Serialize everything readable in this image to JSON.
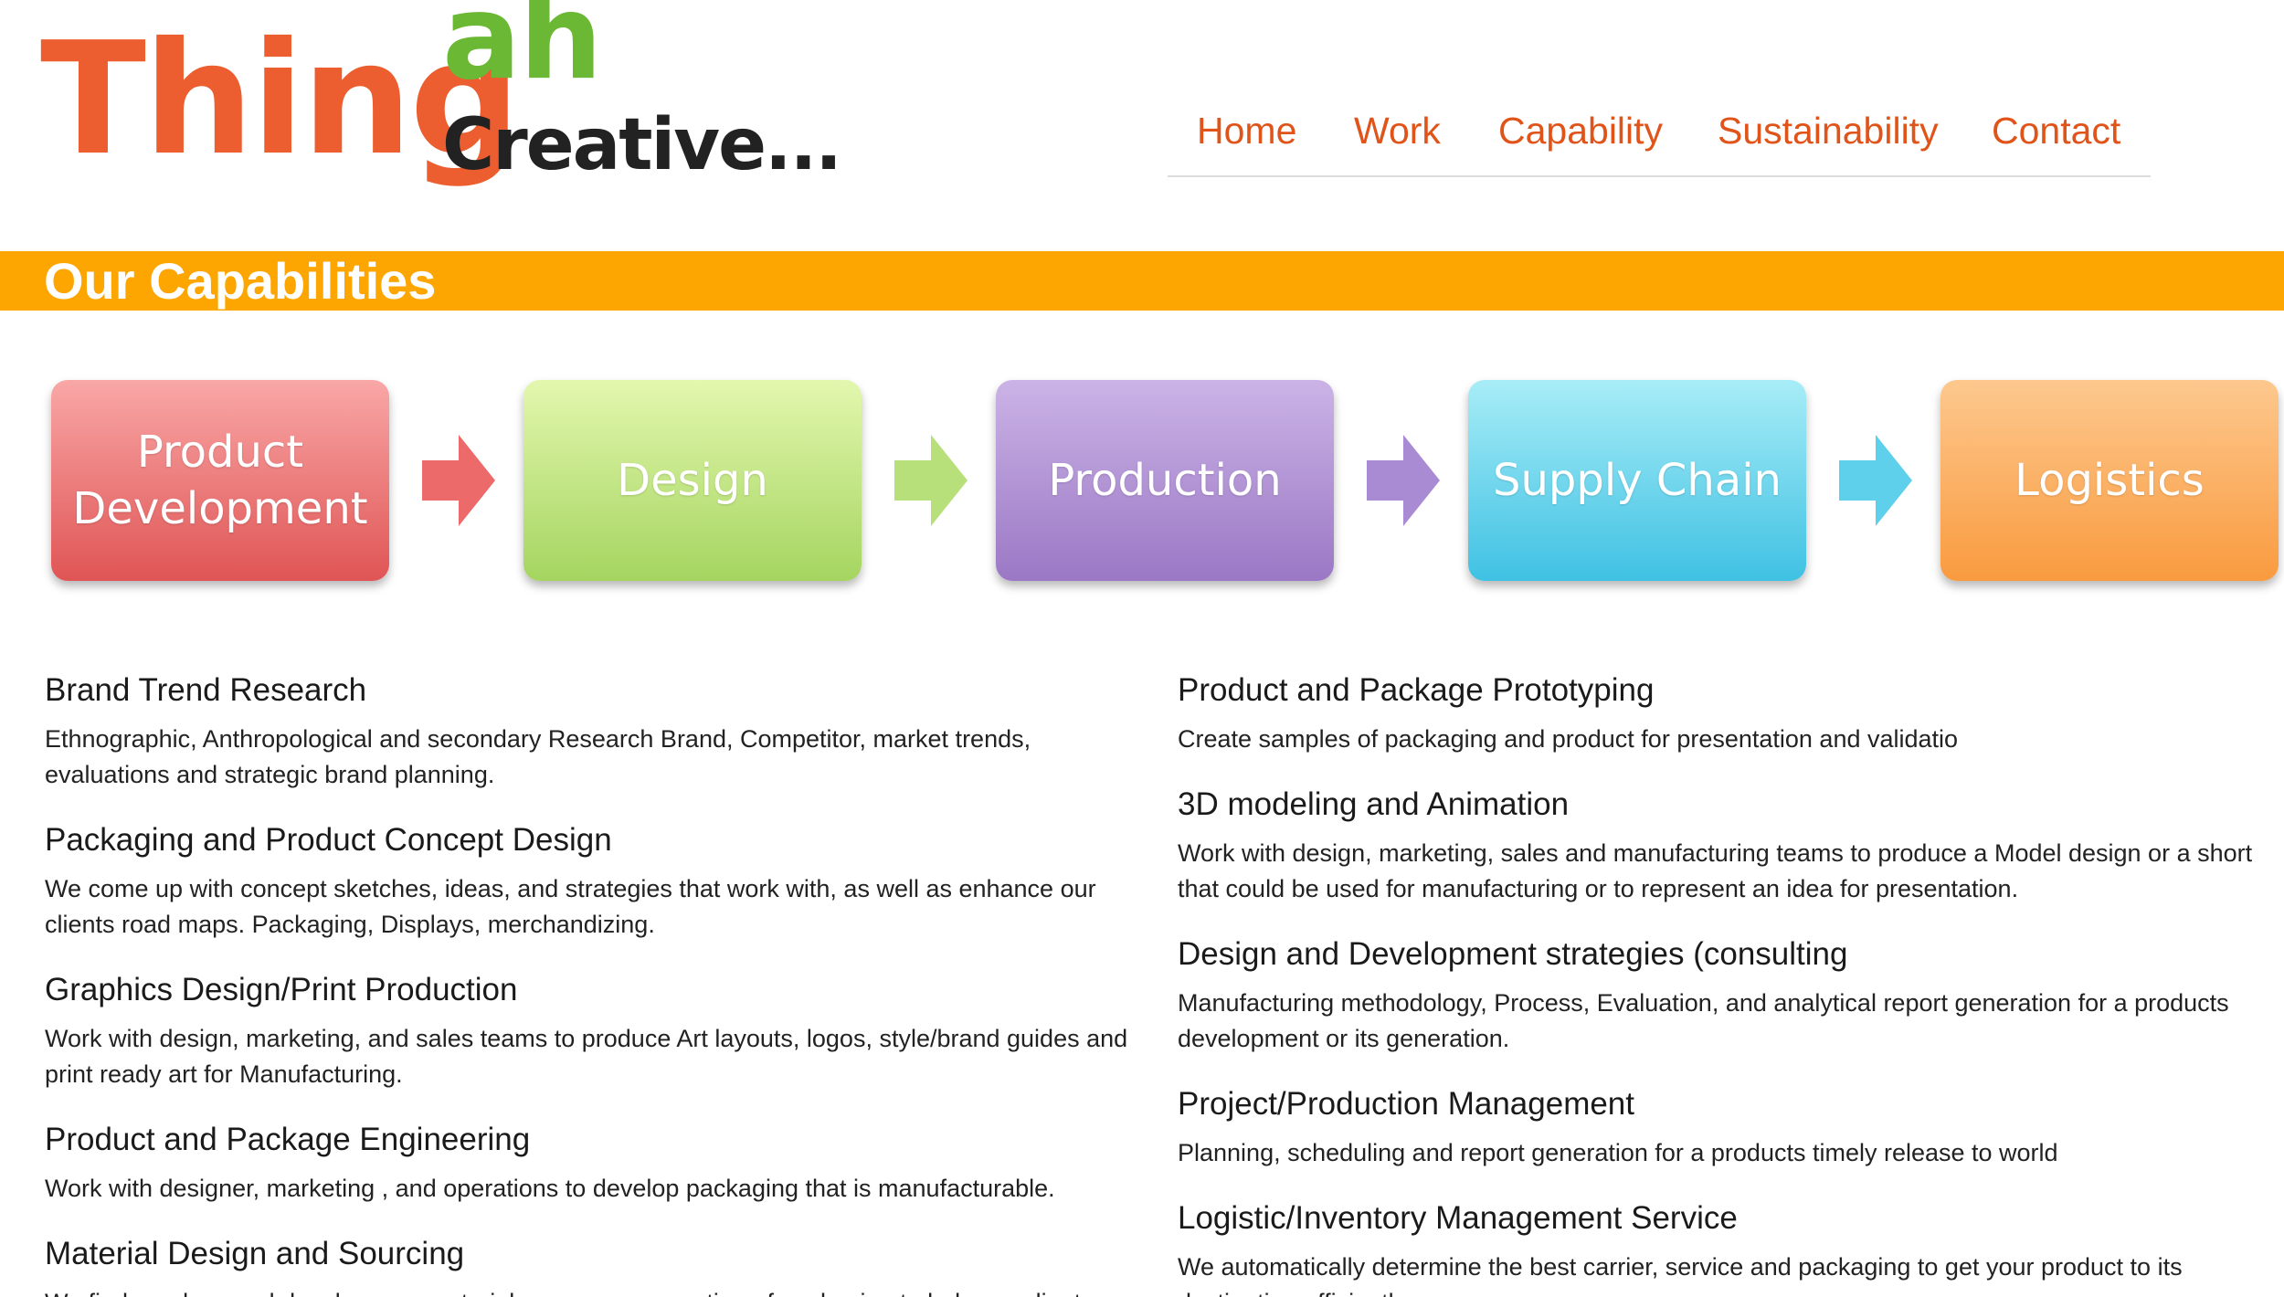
{
  "logo": {
    "part_thing": "Thing",
    "part_ah": "ah",
    "part_creative": "Creative..."
  },
  "nav": {
    "items": [
      {
        "label": "Home"
      },
      {
        "label": "Work"
      },
      {
        "label": "Capability"
      },
      {
        "label": "Sustainability"
      },
      {
        "label": "Contact"
      }
    ]
  },
  "section": {
    "title": "Our Capabilities"
  },
  "process": {
    "steps": [
      {
        "label": "Product Development"
      },
      {
        "label": "Design"
      },
      {
        "label": "Production"
      },
      {
        "label": "Supply Chain"
      },
      {
        "label": "Logistics"
      }
    ],
    "arrow_colors": [
      "#ec6a6a",
      "#b8e07a",
      "#a98bd3",
      "#5fd0ec"
    ]
  },
  "capabilities": {
    "left": [
      {
        "title": "Brand Trend Research",
        "desc": "Ethnographic, Anthropological and secondary Research Brand, Competitor, market trends, evaluations and strategic brand planning."
      },
      {
        "title": "Packaging and Product Concept Design",
        "desc": "We come up with concept sketches, ideas, and strategies that work with, as well as enhance our clients road maps. Packaging, Displays, merchandizing."
      },
      {
        "title": "Graphics Design/Print Production",
        "desc": "Work with design, marketing, and sales teams to produce Art layouts, logos, style/brand guides and print ready art for Manufacturing."
      },
      {
        "title": "Product and Package Engineering",
        "desc": "Work with designer, marketing , and operations to develop packaging that is manufacturable."
      },
      {
        "title": "Material Design and Sourcing",
        "desc": "We find, analyze and develop new materials, process, execution of packaging to help our clients"
      }
    ],
    "right": [
      {
        "title": "Product and Package Prototyping",
        "desc": "Create samples of packaging and product for presentation and validatio"
      },
      {
        "title": "3D modeling  and Animation",
        "desc": "Work with design, marketing, sales and manufacturing teams to produce a Model design or a short that could be used for manufacturing or to represent an idea for presentation."
      },
      {
        "title": "Design and Development strategies (consulting",
        "desc": "Manufacturing methodology, Process, Evaluation, and analytical report generation for a products development or its generation."
      },
      {
        "title": "Project/Production Management",
        "desc": "Planning, scheduling and report generation for a products timely release to world"
      },
      {
        "title": "Logistic/Inventory Management Service",
        "desc": "We automatically determine the best carrier, service and packaging to get your product to its destination efficiently."
      }
    ]
  }
}
